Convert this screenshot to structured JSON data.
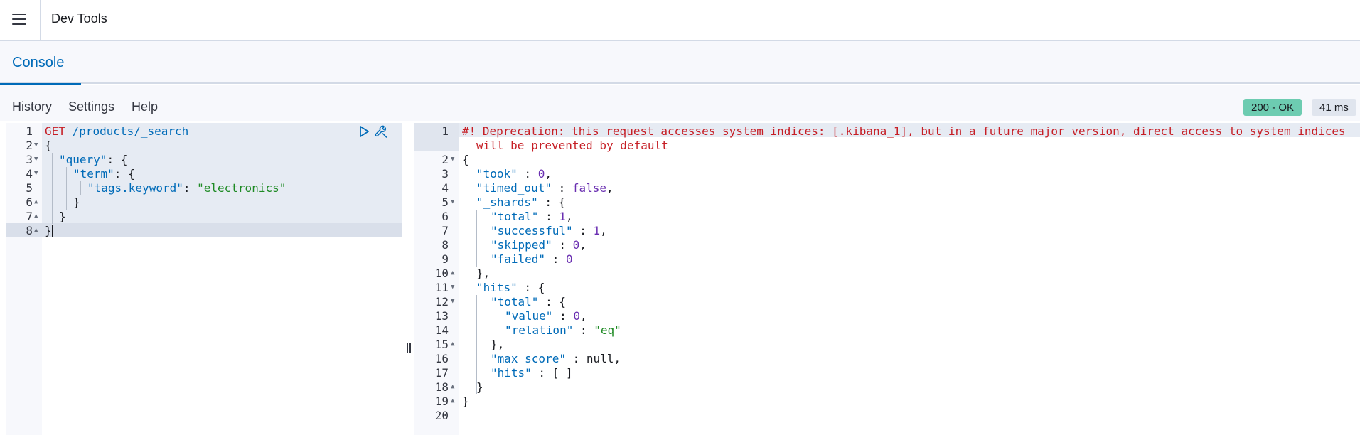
{
  "app": {
    "title": "Dev Tools"
  },
  "tabs": [
    {
      "label": "Console",
      "active": true
    }
  ],
  "toolbar": {
    "history_label": "History",
    "settings_label": "Settings",
    "help_label": "Help",
    "status": "200 - OK",
    "time": "41 ms"
  },
  "request": {
    "method": "GET",
    "path": "/products/_search",
    "lines": [
      {
        "num": "1"
      },
      {
        "num": "2",
        "text": "{"
      },
      {
        "num": "3",
        "key": "\"query\"",
        "rest": ": {"
      },
      {
        "num": "4",
        "key": "\"term\"",
        "rest": ": {"
      },
      {
        "num": "5",
        "key": "\"tags.keyword\"",
        "rest": ": ",
        "str": "\"electronics\""
      },
      {
        "num": "6",
        "text": "}"
      },
      {
        "num": "7",
        "text": "}"
      },
      {
        "num": "8",
        "text": "}"
      }
    ]
  },
  "response": {
    "warning_line1": "#! Deprecation: this request accesses system indices: [.kibana_1], but in a future major version, direct access to system indices",
    "warning_line2": "will be prevented by default",
    "line_numbers": [
      "1",
      "2",
      "3",
      "4",
      "5",
      "6",
      "7",
      "8",
      "9",
      "10",
      "11",
      "12",
      "13",
      "14",
      "15",
      "16",
      "17",
      "18",
      "19",
      "20"
    ],
    "l2": "{",
    "l3_key": "\"took\"",
    "l3_val": "0",
    "l4_key": "\"timed_out\"",
    "l4_val": "false",
    "l5_key": "\"_shards\"",
    "l5_rest": " : {",
    "l6_key": "\"total\"",
    "l6_val": "1",
    "l7_key": "\"successful\"",
    "l7_val": "1",
    "l8_key": "\"skipped\"",
    "l8_val": "0",
    "l9_key": "\"failed\"",
    "l9_val": "0",
    "l10": "},",
    "l11_key": "\"hits\"",
    "l11_rest": " : {",
    "l12_key": "\"total\"",
    "l12_rest": " : {",
    "l13_key": "\"value\"",
    "l13_val": "0",
    "l14_key": "\"relation\"",
    "l14_val": "\"eq\"",
    "l15": "},",
    "l16_key": "\"max_score\"",
    "l16_val": "null",
    "l17_key": "\"hits\"",
    "l17_rest": " : [ ]",
    "l18": "}",
    "l19": "}"
  },
  "colors": {
    "accent": "#006bb8",
    "status_ok": "#6dccb1",
    "string": "#1e8a24",
    "number": "#6a2fb1",
    "warning": "#c61e25"
  }
}
